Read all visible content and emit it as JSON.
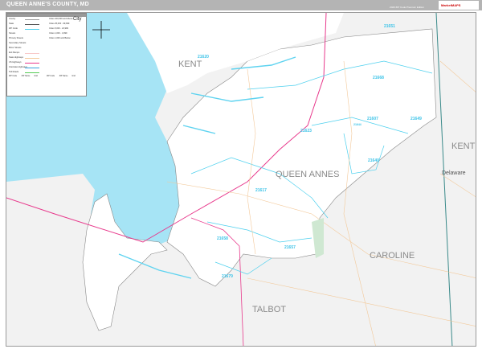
{
  "header": {
    "title": "QUEEN ANNE'S COUNTY, MD",
    "edition": "2020 ZIP Code Premium Edition",
    "logo": "MarketMAPS"
  },
  "legend": {
    "items": [
      "County",
      "State",
      "ZIP Code",
      "Streets",
      "Primary Streets",
      "Secondary Streets",
      "Minor Streets",
      "Exit Ramps",
      "State Highways",
      "US Highways",
      "Interstate Highways",
      "Toll Roads"
    ],
    "cities": [
      "Cities 100,000 and Above",
      "Cities 25,000 - 99,999",
      "Cities 5,000 - 24,999",
      "Cities 1,000 - 4,999",
      "Cities 1,000 and Below"
    ],
    "city_sample": "City",
    "zip_table_headers": [
      "ZIP Code",
      "ZIP Name",
      "Grid",
      "ZIP Code",
      "ZIP Name",
      "Grid"
    ]
  },
  "map": {
    "zip_labels": [
      "21651",
      "21620",
      "21668",
      "21607",
      "21649",
      "21623",
      "21644",
      "21640",
      "21617",
      "21658",
      "21657",
      "21679"
    ],
    "county_labels": [
      "KENT",
      "KENT",
      "QUEEN ANNES",
      "CAROLINE",
      "TALBOT"
    ],
    "state_labels": [
      "Delaware"
    ],
    "colors": {
      "water": "#a6e4f5",
      "land": "#ffffff",
      "outside": "#f2f2f2",
      "zip_boundary": "#4dd0ee",
      "interstate": "#e8398c",
      "roads": "#f3c99a",
      "state_line": "#3a8a8a"
    }
  }
}
